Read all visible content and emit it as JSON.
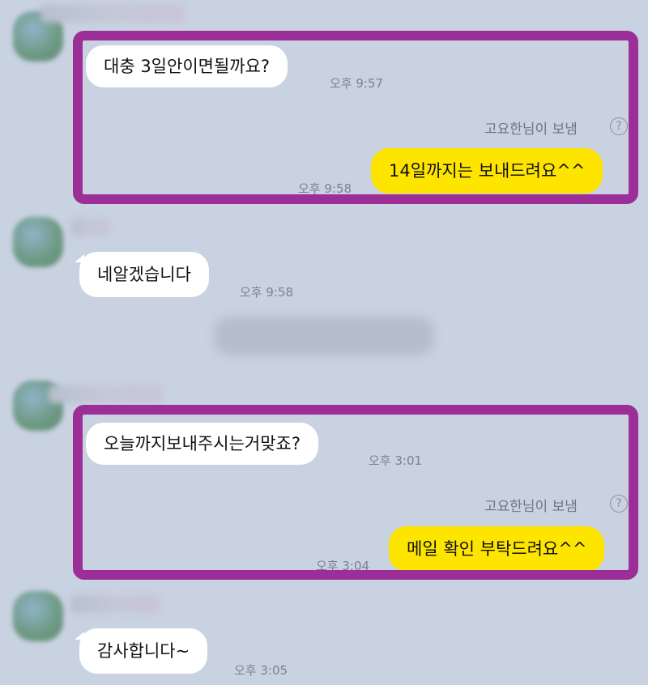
{
  "chat": {
    "section1": {
      "incoming_message": "대충 3일안이면될까요?",
      "incoming_time": "오후 9:57",
      "sender_note": "고요한님이 보냄",
      "outgoing_message": "14일까지는 보내드려요^^",
      "outgoing_time": "오후 9:58"
    },
    "section2": {
      "incoming_message": "네알겠습니다",
      "incoming_time": "오후 9:58"
    },
    "section3": {
      "incoming_message": "오늘까지보내주시는거맞죠?",
      "incoming_time": "오후 3:01",
      "sender_note": "고요한님이 보냄",
      "outgoing_message": "메일 확인 부탁드려요^^",
      "outgoing_time": "오후 3:04"
    },
    "section4": {
      "incoming_message": "감사합니다~",
      "incoming_time": "오후 3:05"
    },
    "help_glyph": "?"
  },
  "colors": {
    "background": "#c9d2e1",
    "outgoing_bubble": "#fee500",
    "incoming_bubble": "#ffffff",
    "highlight_border": "#9b2f97"
  }
}
